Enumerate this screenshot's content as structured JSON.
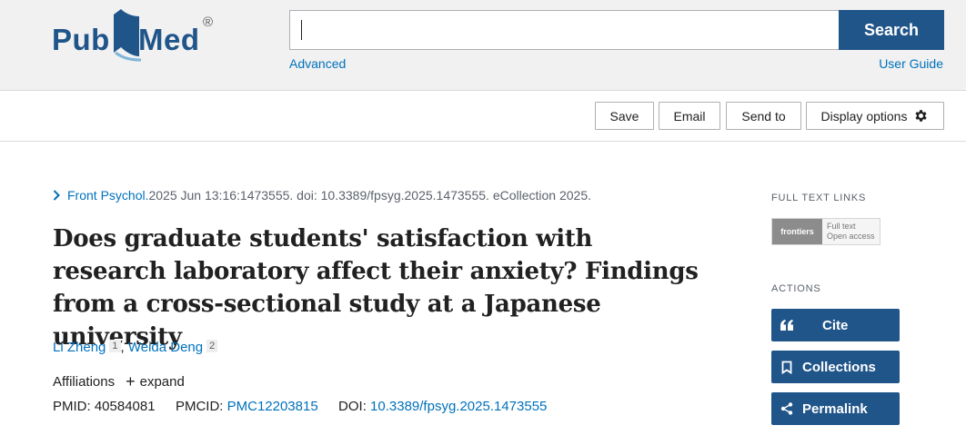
{
  "header": {
    "logo_pub": "Pub",
    "logo_med": "Med",
    "logo_reg": "®",
    "search_value": "",
    "search_button": "Search",
    "advanced_link": "Advanced",
    "user_guide_link": "User Guide"
  },
  "toolbar": {
    "save": "Save",
    "email": "Email",
    "send_to": "Send to",
    "display_options": "Display options"
  },
  "article": {
    "journal": "Front Psychol.",
    "citation_rest": " 2025 Jun 13:16:1473555. doi: 10.3389/fpsyg.2025.1473555. eCollection 2025.",
    "title": "Does graduate students' satisfaction with research laboratory affect their anxiety? Findings from a cross-sectional study at a Japanese university",
    "authors": [
      {
        "name": "Li Zheng",
        "affil": "1"
      },
      {
        "name": "Weida Deng",
        "affil": "2"
      }
    ],
    "author_sep": ", ",
    "affiliations_label": "Affiliations",
    "expand_label": "expand",
    "pmid_label": "PMID: ",
    "pmid": "40584081",
    "pmcid_label": "PMCID: ",
    "pmcid": "PMC12203815",
    "doi_label": "DOI: ",
    "doi": "10.3389/fpsyg.2025.1473555"
  },
  "sidebar": {
    "full_text_links": "FULL TEXT LINKS",
    "frontiers_logo": "frontiers",
    "frontiers_line1": "Full text",
    "frontiers_line2": "Open access",
    "actions": "ACTIONS",
    "cite": "Cite",
    "collections": "Collections",
    "permalink": "Permalink"
  },
  "colors": {
    "brand": "#20558a",
    "link": "#0071bc"
  },
  "icons": [
    "pubmed-book-icon",
    "gear-icon",
    "chevron-right-icon",
    "plus-icon",
    "quote-icon",
    "bookmark-icon",
    "share-icon"
  ]
}
